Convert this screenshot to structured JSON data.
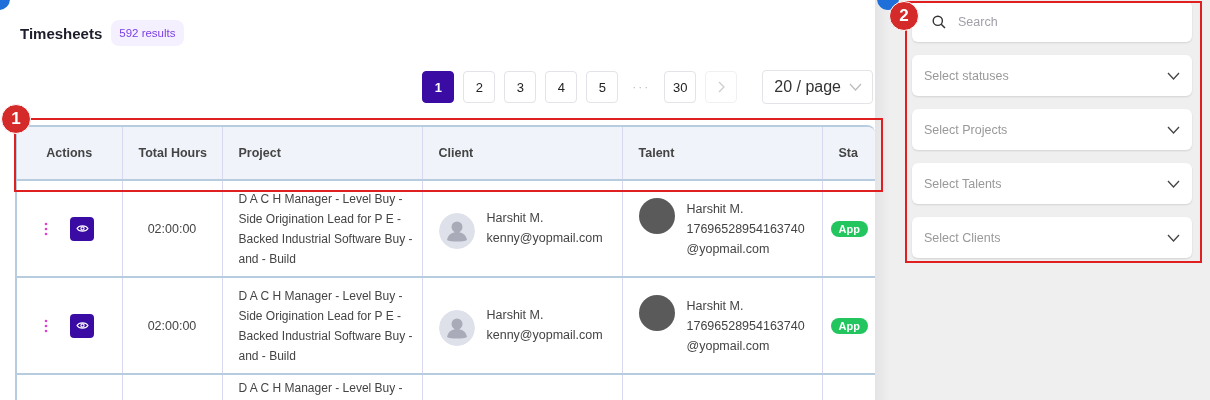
{
  "header": {
    "title": "Timesheets",
    "count": "592 results"
  },
  "pagination": {
    "items": [
      {
        "kind": "page",
        "label": "1",
        "selected": true
      },
      {
        "kind": "page",
        "label": "2",
        "selected": false
      },
      {
        "kind": "page",
        "label": "3",
        "selected": false
      },
      {
        "kind": "page",
        "label": "4",
        "selected": false
      },
      {
        "kind": "page",
        "label": "5",
        "selected": false
      },
      {
        "kind": "ellipsis",
        "label": "···"
      },
      {
        "kind": "page",
        "label": "30",
        "selected": false
      },
      {
        "kind": "next",
        "disabled": true
      }
    ],
    "page_size": "20 / page"
  },
  "table": {
    "columns": [
      "Actions",
      "Total Hours",
      "Project",
      "Client",
      "Talent",
      "Sta"
    ],
    "rows": [
      {
        "hours": "02:00:00",
        "project": "D A C H Manager - Level Buy - Side Origination Lead for P E - Backed Industrial Software Buy -and - Build",
        "client": {
          "name": "Harshit M.",
          "email": "kenny@yopmail.com"
        },
        "talent": {
          "name": "Harshit M.",
          "email": "17696528954163740@yopmail.com"
        },
        "status": "App"
      },
      {
        "hours": "02:00:00",
        "project": "D A C H Manager - Level Buy - Side Origination Lead for P E - Backed Industrial Software Buy -and - Build",
        "client": {
          "name": "Harshit M.",
          "email": "kenny@yopmail.com"
        },
        "talent": {
          "name": "Harshit M.",
          "email": "17696528954163740@yopmail.com"
        },
        "status": "App"
      },
      {
        "project": "D A C H Manager - Level Buy -"
      }
    ]
  },
  "filters": {
    "search": {
      "placeholder": "Search"
    },
    "selects": [
      "Select statuses",
      "Select Projects",
      "Select Talents",
      "Select Clients"
    ]
  },
  "annotations": [
    {
      "label": "1"
    },
    {
      "label": "2"
    }
  ]
}
